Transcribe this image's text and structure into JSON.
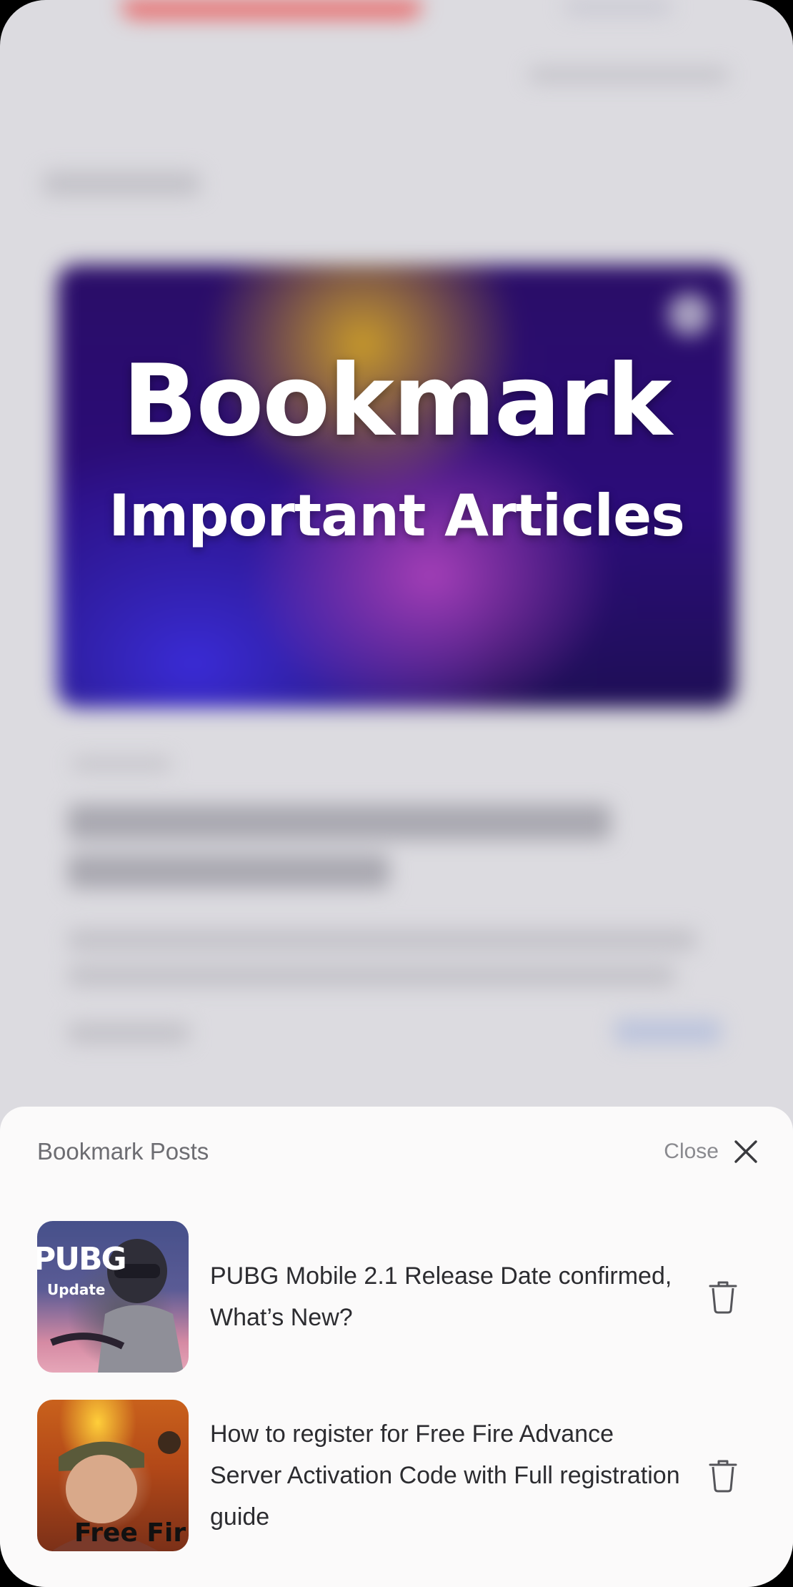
{
  "overlay": {
    "headline": "Bookmark",
    "subheadline": "Important Articles"
  },
  "sheet": {
    "title": "Bookmark Posts",
    "close_label": "Close",
    "items": [
      {
        "title": "PUBG Mobile 2.1 Release Date confirmed, What’s New?",
        "thumb_text_1": "PUBG",
        "thumb_text_2": "Update"
      },
      {
        "title": "How to register for Free Fire Advance Server Activation Code with Full registration guide",
        "thumb_text_1": "Free Fir"
      }
    ]
  },
  "icons": {
    "close": "close-icon",
    "delete": "trash-icon"
  },
  "colors": {
    "sheet_bg": "#fbfafa",
    "hero_purple": "#2b0c7a",
    "text_dark": "#2c2c30",
    "text_muted": "#6d6d72"
  }
}
